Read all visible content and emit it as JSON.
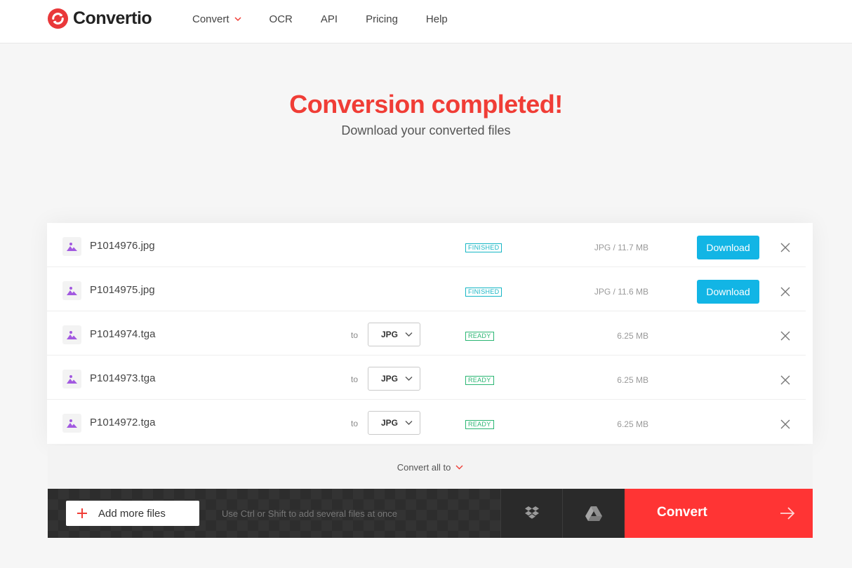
{
  "header": {
    "logo_text": "Convertio",
    "nav": [
      {
        "label": "Convert",
        "has_dropdown": true
      },
      {
        "label": "OCR"
      },
      {
        "label": "API"
      },
      {
        "label": "Pricing"
      },
      {
        "label": "Help"
      }
    ]
  },
  "hero": {
    "title": "Conversion completed!",
    "subtitle": "Download your converted files"
  },
  "files": [
    {
      "name": "P1014976.jpg",
      "status": "FINISHED",
      "size": "JPG / 11.7 MB",
      "action": "Download",
      "icon": "image-icon"
    },
    {
      "name": "P1014975.jpg",
      "status": "FINISHED",
      "size": "JPG / 11.6 MB",
      "action": "Download",
      "icon": "image-icon"
    },
    {
      "name": "P1014974.tga",
      "to": "to",
      "format": "JPG",
      "status": "READY",
      "size": "6.25 MB",
      "icon": "image-icon"
    },
    {
      "name": "P1014973.tga",
      "to": "to",
      "format": "JPG",
      "status": "READY",
      "size": "6.25 MB",
      "icon": "image-icon"
    },
    {
      "name": "P1014972.tga",
      "to": "to",
      "format": "JPG",
      "status": "READY",
      "size": "6.25 MB",
      "icon": "image-icon"
    }
  ],
  "convert_all": {
    "label": "Convert all to"
  },
  "bottom": {
    "add_files_label": "Add more files",
    "hint": "Use Ctrl or Shift to add several files at once",
    "convert_label": "Convert"
  },
  "colors": {
    "accent": "#f03d36",
    "download": "#12b5e5",
    "finished": "#17b6c5",
    "ready": "#2bb673",
    "convert": "#ff3434"
  }
}
